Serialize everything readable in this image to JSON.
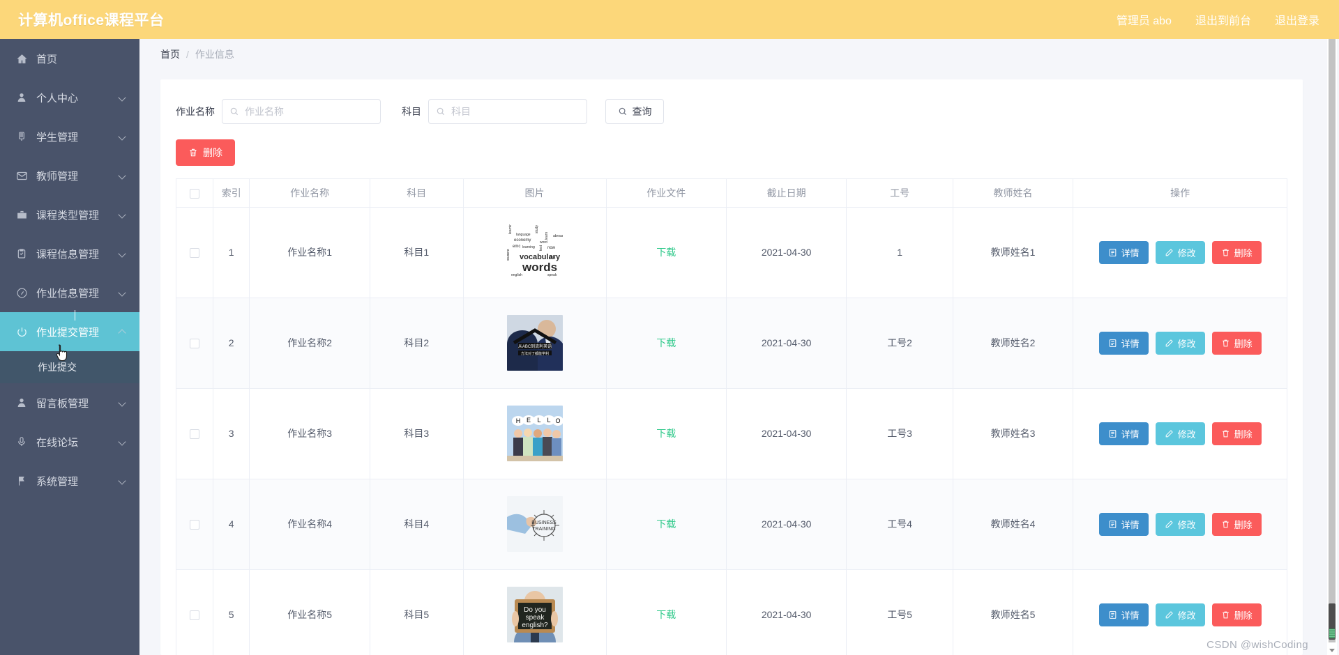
{
  "header": {
    "brand": "计算机office课程平台",
    "nav": [
      {
        "label": "管理员 abo",
        "name": "admin-user"
      },
      {
        "label": "退出到前台",
        "name": "back-to-front"
      },
      {
        "label": "退出登录",
        "name": "logout"
      }
    ]
  },
  "sidebar": {
    "items": [
      {
        "label": "首页",
        "icon": "home-icon",
        "arrow": false,
        "active": false
      },
      {
        "label": "个人中心",
        "icon": "user-icon",
        "arrow": true,
        "active": false
      },
      {
        "label": "学生管理",
        "icon": "student-icon",
        "arrow": true,
        "active": false
      },
      {
        "label": "教师管理",
        "icon": "mail-icon",
        "arrow": true,
        "active": false
      },
      {
        "label": "课程类型管理",
        "icon": "briefcase-icon",
        "arrow": true,
        "active": false
      },
      {
        "label": "课程信息管理",
        "icon": "clipboard-icon",
        "arrow": true,
        "active": false
      },
      {
        "label": "作业信息管理",
        "icon": "compass-icon",
        "arrow": true,
        "active": false
      },
      {
        "label": "作业提交管理",
        "icon": "power-icon",
        "arrow": true,
        "active": true
      },
      {
        "label": "留言板管理",
        "icon": "user-icon",
        "arrow": true,
        "active": false
      },
      {
        "label": "在线论坛",
        "icon": "mic-icon",
        "arrow": true,
        "active": false
      },
      {
        "label": "系统管理",
        "icon": "flag-icon",
        "arrow": true,
        "active": false
      }
    ],
    "submenu": [
      {
        "label": "作业提交"
      }
    ]
  },
  "breadcrumb": {
    "home": "首页",
    "separator": "/",
    "current": "作业信息"
  },
  "search": {
    "name_label": "作业名称",
    "name_placeholder": "作业名称",
    "name_value": "",
    "subject_label": "科目",
    "subject_placeholder": "科目",
    "subject_value": "",
    "query_label": "查询",
    "query_icon": "search-icon"
  },
  "toolbar": {
    "delete_label": "删除",
    "delete_icon": "trash-icon"
  },
  "table": {
    "columns": [
      {
        "key": "check",
        "label": ""
      },
      {
        "key": "index",
        "label": "索引"
      },
      {
        "key": "name",
        "label": "作业名称"
      },
      {
        "key": "subject",
        "label": "科目"
      },
      {
        "key": "image",
        "label": "图片"
      },
      {
        "key": "file",
        "label": "作业文件"
      },
      {
        "key": "deadline",
        "label": "截止日期"
      },
      {
        "key": "employee_no",
        "label": "工号"
      },
      {
        "key": "teacher",
        "label": "教师姓名"
      },
      {
        "key": "ops",
        "label": "操作"
      }
    ],
    "download_label": "下载",
    "row_actions": [
      {
        "label": "详情",
        "icon": "document-icon",
        "style": "detail"
      },
      {
        "label": "修改",
        "icon": "pencil-icon",
        "style": "edit"
      },
      {
        "label": "删除",
        "icon": "trash-icon",
        "style": "remove"
      }
    ],
    "rows": [
      {
        "index": "1",
        "name": "作业名称1",
        "subject": "科目1",
        "image": "wordcloud-vocabulary-words",
        "file": "下载",
        "deadline": "2021-04-30",
        "employee_no": "1",
        "teacher": "教师姓名1"
      },
      {
        "index": "2",
        "name": "作业名称2",
        "subject": "科目2",
        "image": "student-desk-abc-english",
        "file": "下载",
        "deadline": "2021-04-30",
        "employee_no": "工号2",
        "teacher": "教师姓名2"
      },
      {
        "index": "3",
        "name": "作业名称3",
        "subject": "科目3",
        "image": "hello-cartoon-people",
        "file": "下载",
        "deadline": "2021-04-30",
        "employee_no": "工号3",
        "teacher": "教师姓名3"
      },
      {
        "index": "4",
        "name": "作业名称4",
        "subject": "科目4",
        "image": "business-training-sun",
        "file": "下载",
        "deadline": "2021-04-30",
        "employee_no": "工号4",
        "teacher": "教师姓名4"
      },
      {
        "index": "5",
        "name": "作业名称5",
        "subject": "科目5",
        "image": "do-you-speak-english-blackboard",
        "file": "下载",
        "deadline": "2021-04-30",
        "employee_no": "工号5",
        "teacher": "教师姓名5"
      }
    ]
  },
  "watermark": "CSDN @wishCoding",
  "colors": {
    "header_bg": "#fcd77a",
    "sidebar_bg": "#49536a",
    "active_bg": "#5ec3d4",
    "submenu_bg": "#41566a",
    "danger": "#fb5b5b",
    "primary": "#3d8ecb",
    "edit": "#5bc6dd",
    "link": "#2fc98a"
  }
}
